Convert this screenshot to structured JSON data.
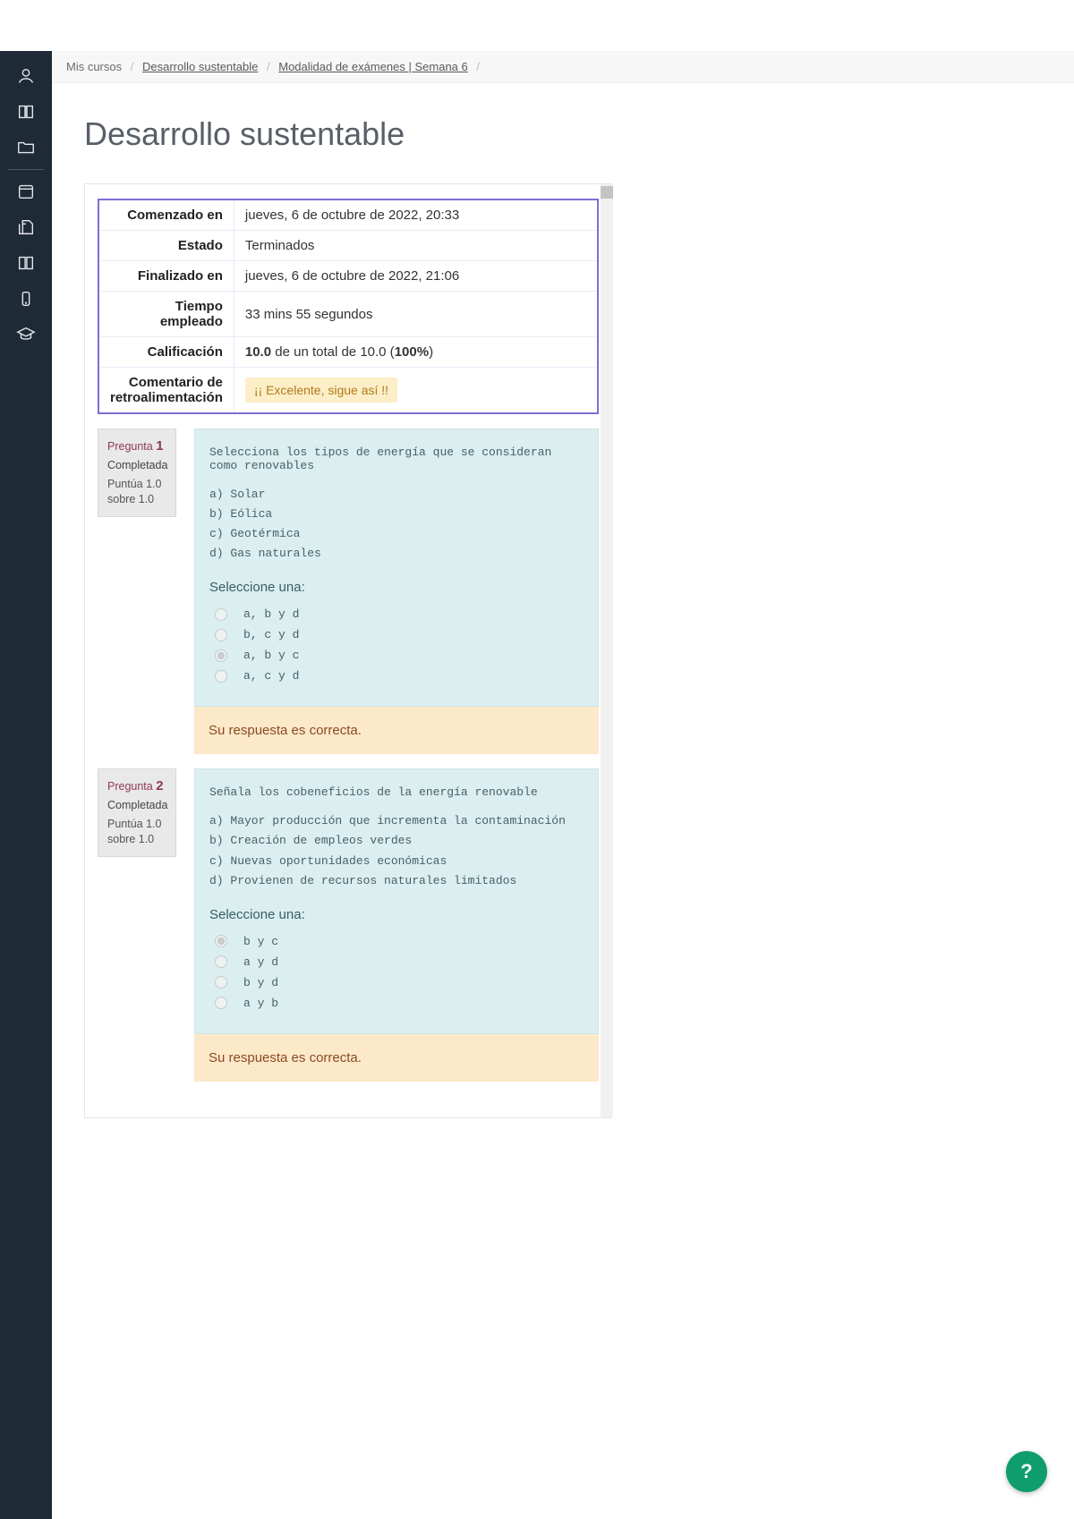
{
  "breadcrumb": {
    "root": "Mis cursos",
    "course": "Desarrollo sustentable",
    "section": "Modalidad de exámenes | Semana 6"
  },
  "title": "Desarrollo sustentable",
  "summary": {
    "rows": [
      {
        "label": "Comenzado en",
        "value": "jueves, 6 de octubre de 2022, 20:33"
      },
      {
        "label": "Estado",
        "value": "Terminados"
      },
      {
        "label": "Finalizado en",
        "value": "jueves, 6 de octubre de 2022, 21:06"
      },
      {
        "label": "Tiempo empleado",
        "value": "33 mins 55 segundos"
      }
    ],
    "grade_label": "Calificación",
    "grade_score": "10.0",
    "grade_rest": " de un total de 10.0 (",
    "grade_pct": "100%",
    "grade_close": ")",
    "feedback_label": "Comentario de retroalimentación",
    "feedback_text": "¡¡ Excelente, sigue así !!"
  },
  "labels": {
    "question": "Pregunta",
    "select_one": "Seleccione una:",
    "correct": "Su respuesta es correcta."
  },
  "questions": [
    {
      "number": "1",
      "state": "Completada",
      "points": "Puntúa 1.0 sobre 1.0",
      "prompt": "Selecciona los tipos de energía que se consideran como renovables",
      "items": [
        "a) Solar",
        "b) Eólica",
        "c) Geotérmica",
        "d) Gas naturales"
      ],
      "options": [
        {
          "text": "a, b y d",
          "checked": false
        },
        {
          "text": "b, c y d",
          "checked": false
        },
        {
          "text": "a, b y c",
          "checked": true
        },
        {
          "text": "a, c y d",
          "checked": false
        }
      ]
    },
    {
      "number": "2",
      "state": "Completada",
      "points": "Puntúa 1.0 sobre 1.0",
      "prompt": "Señala los cobeneficios de la energía renovable",
      "items": [
        "a) Mayor producción que incrementa la contaminación",
        "b) Creación de empleos verdes",
        "c) Nuevas oportunidades económicas",
        "d) Provienen de recursos naturales limitados"
      ],
      "options": [
        {
          "text": "b y c",
          "checked": true
        },
        {
          "text": "a y d",
          "checked": false
        },
        {
          "text": "b y d",
          "checked": false
        },
        {
          "text": "a y b",
          "checked": false
        }
      ]
    }
  ],
  "fab": "?"
}
